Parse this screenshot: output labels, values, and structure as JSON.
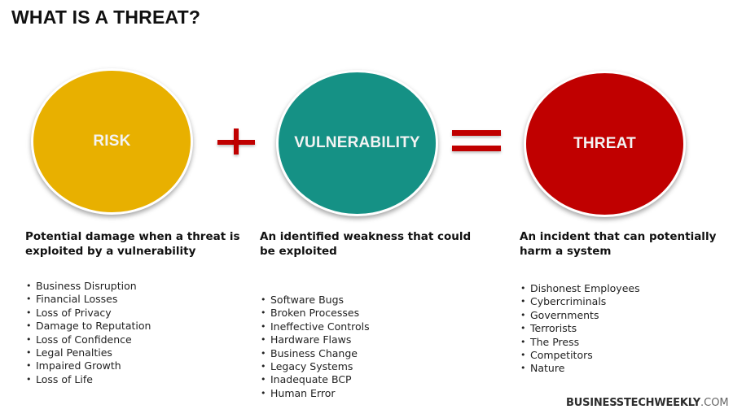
{
  "title": "WHAT IS A THREAT?",
  "colors": {
    "risk": "#e8b000",
    "vulnerability": "#159185",
    "threat": "#c00000",
    "operator": "#c00000"
  },
  "equation": {
    "operand1": "RISK",
    "operator1": "plus",
    "operand2": "VULNERABILITY",
    "operator2": "equals",
    "result": "THREAT"
  },
  "columns": {
    "risk": {
      "heading": "Potential damage when a threat is exploited by a vulnerability",
      "items": [
        "Business Disruption",
        "Financial Losses",
        "Loss of Privacy",
        "Damage to Reputation",
        "Loss of Confidence",
        "Legal Penalties",
        "Impaired Growth",
        "Loss of Life"
      ]
    },
    "vulnerability": {
      "heading": "An identified weakness that could be exploited",
      "items": [
        "Software Bugs",
        "Broken Processes",
        "Ineffective Controls",
        "Hardware Flaws",
        "Business Change",
        "Legacy Systems",
        "Inadequate BCP",
        "Human Error"
      ]
    },
    "threat": {
      "heading": "An incident that can potentially harm a system",
      "items": [
        "Dishonest Employees",
        "Cybercriminals",
        "Governments",
        "Terrorists",
        "The Press",
        "Competitors",
        "Nature"
      ]
    }
  },
  "brand": {
    "name": "BUSINESSTECHWEEKLY",
    "domain": ".COM"
  }
}
